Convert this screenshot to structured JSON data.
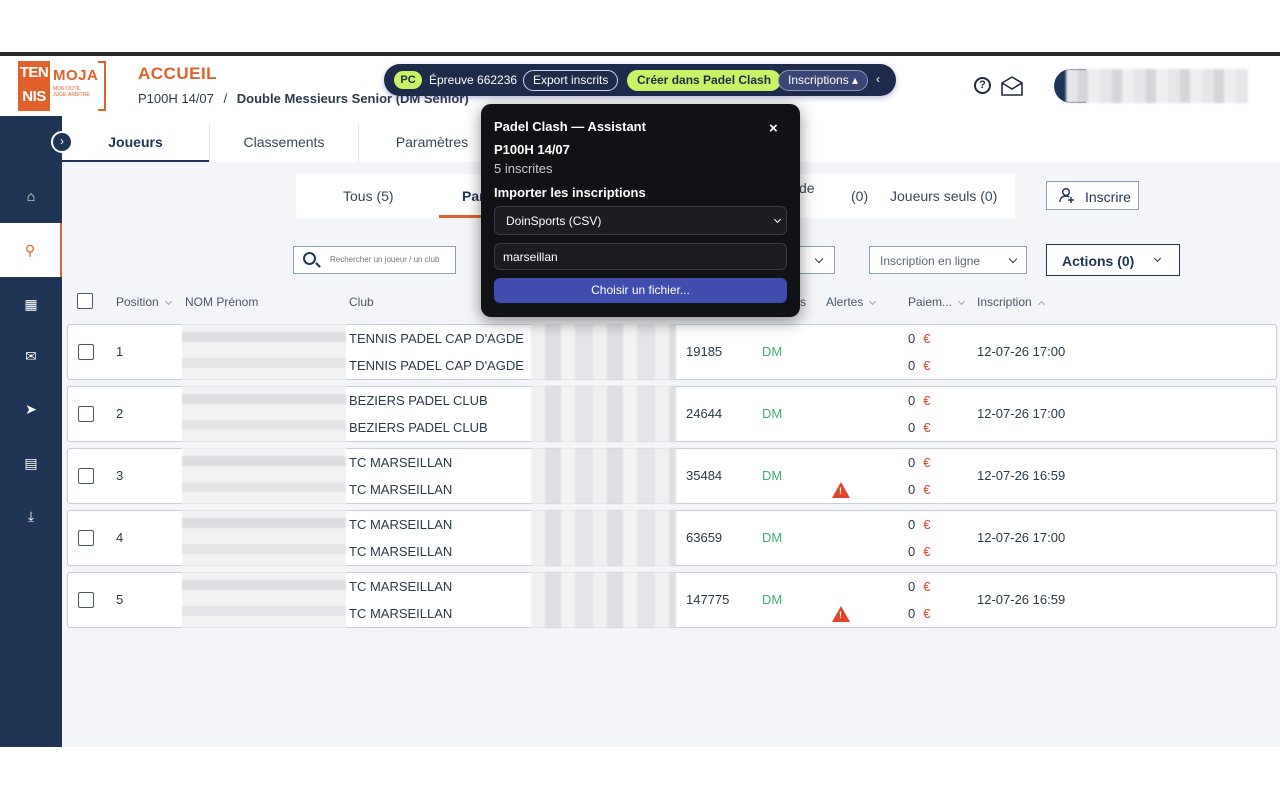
{
  "header": {
    "logo": {
      "ten": "TEN",
      "nis": "NIS",
      "moja": "MOJA",
      "sub": "MON OUTIL JUGE-ARBITRE"
    },
    "title": "ACCUEIL",
    "breadcrumb": {
      "event": "P100H 14/07",
      "sep": "/",
      "category": "Double Messieurs Senior (DM Senior)"
    }
  },
  "pc_bar": {
    "badge": "PC",
    "epreuve": "Épreuve 662236",
    "export": "Export inscrits",
    "create": "Créer dans Padel Clash",
    "inscriptions": "Inscriptions ▴",
    "collapse": "‹"
  },
  "sidebar": {
    "toggle": "›",
    "items": [
      {
        "icon": "home-icon",
        "glyph": "⌂"
      },
      {
        "icon": "players-icon",
        "glyph": "⚲"
      },
      {
        "icon": "calendar-icon",
        "glyph": "▦"
      },
      {
        "icon": "mail-icon",
        "glyph": "✉"
      },
      {
        "icon": "send-icon",
        "glyph": "➤"
      },
      {
        "icon": "grid-icon",
        "glyph": "▤"
      },
      {
        "icon": "download-icon",
        "glyph": "⤓"
      }
    ]
  },
  "tabs": [
    "Joueurs",
    "Classements",
    "Paramètres"
  ],
  "filters": {
    "tous": "Tous (5)",
    "partial": "Par",
    "de": "de",
    "zero": "(0)",
    "seuls": "Joueurs seuls (0)"
  },
  "inscrire": "Inscrire",
  "search": {
    "placeholder": "Rechercher un joueur / un club"
  },
  "online_select": "Inscription en ligne",
  "actions": "Actions (0)",
  "columns": {
    "position": "Position",
    "name": "NOM Prénom",
    "club": "Club",
    "s": "s",
    "alertes": "Alertes",
    "paiement": "Paiem...",
    "inscription": "Inscription"
  },
  "rows": [
    {
      "pos": "1",
      "club1": "TENNIS PADEL CAP D'AGDE",
      "club2": "TENNIS PADEL CAP D'AGDE",
      "num": "19185",
      "cat": "DM",
      "pay1": "0",
      "pay2": "0",
      "date": "12-07-26 17:00",
      "alert": false
    },
    {
      "pos": "2",
      "club1": "BEZIERS PADEL CLUB",
      "club2": "BEZIERS PADEL CLUB",
      "num": "24644",
      "cat": "DM",
      "pay1": "0",
      "pay2": "0",
      "date": "12-07-26 17:00",
      "alert": false
    },
    {
      "pos": "3",
      "club1": "TC MARSEILLAN",
      "club2": "TC MARSEILLAN",
      "num": "35484",
      "cat": "DM",
      "pay1": "0",
      "pay2": "0",
      "date": "12-07-26 16:59",
      "alert": true
    },
    {
      "pos": "4",
      "club1": "TC MARSEILLAN",
      "club2": "TC MARSEILLAN",
      "num": "63659",
      "cat": "DM",
      "pay1": "0",
      "pay2": "0",
      "date": "12-07-26 17:00",
      "alert": false
    },
    {
      "pos": "5",
      "club1": "TC MARSEILLAN",
      "club2": "TC MARSEILLAN",
      "num": "147775",
      "cat": "DM",
      "pay1": "0",
      "pay2": "0",
      "date": "12-07-26 16:59",
      "alert": true
    }
  ],
  "currency": "€",
  "modal": {
    "title": "Padel Clash — Assistant",
    "close": "×",
    "event": "P100H 14/07",
    "count": "5 inscrites",
    "import_label": "Importer les inscriptions",
    "source": "DoinSports (CSV)",
    "filter_value": "marseillan",
    "file_button": "Choisir un fichier..."
  },
  "colors": {
    "accent": "#e0622a",
    "navy": "#1f3556",
    "lime": "#c9f266",
    "dm_green": "#3fae72",
    "alert_red": "#e0432a"
  }
}
